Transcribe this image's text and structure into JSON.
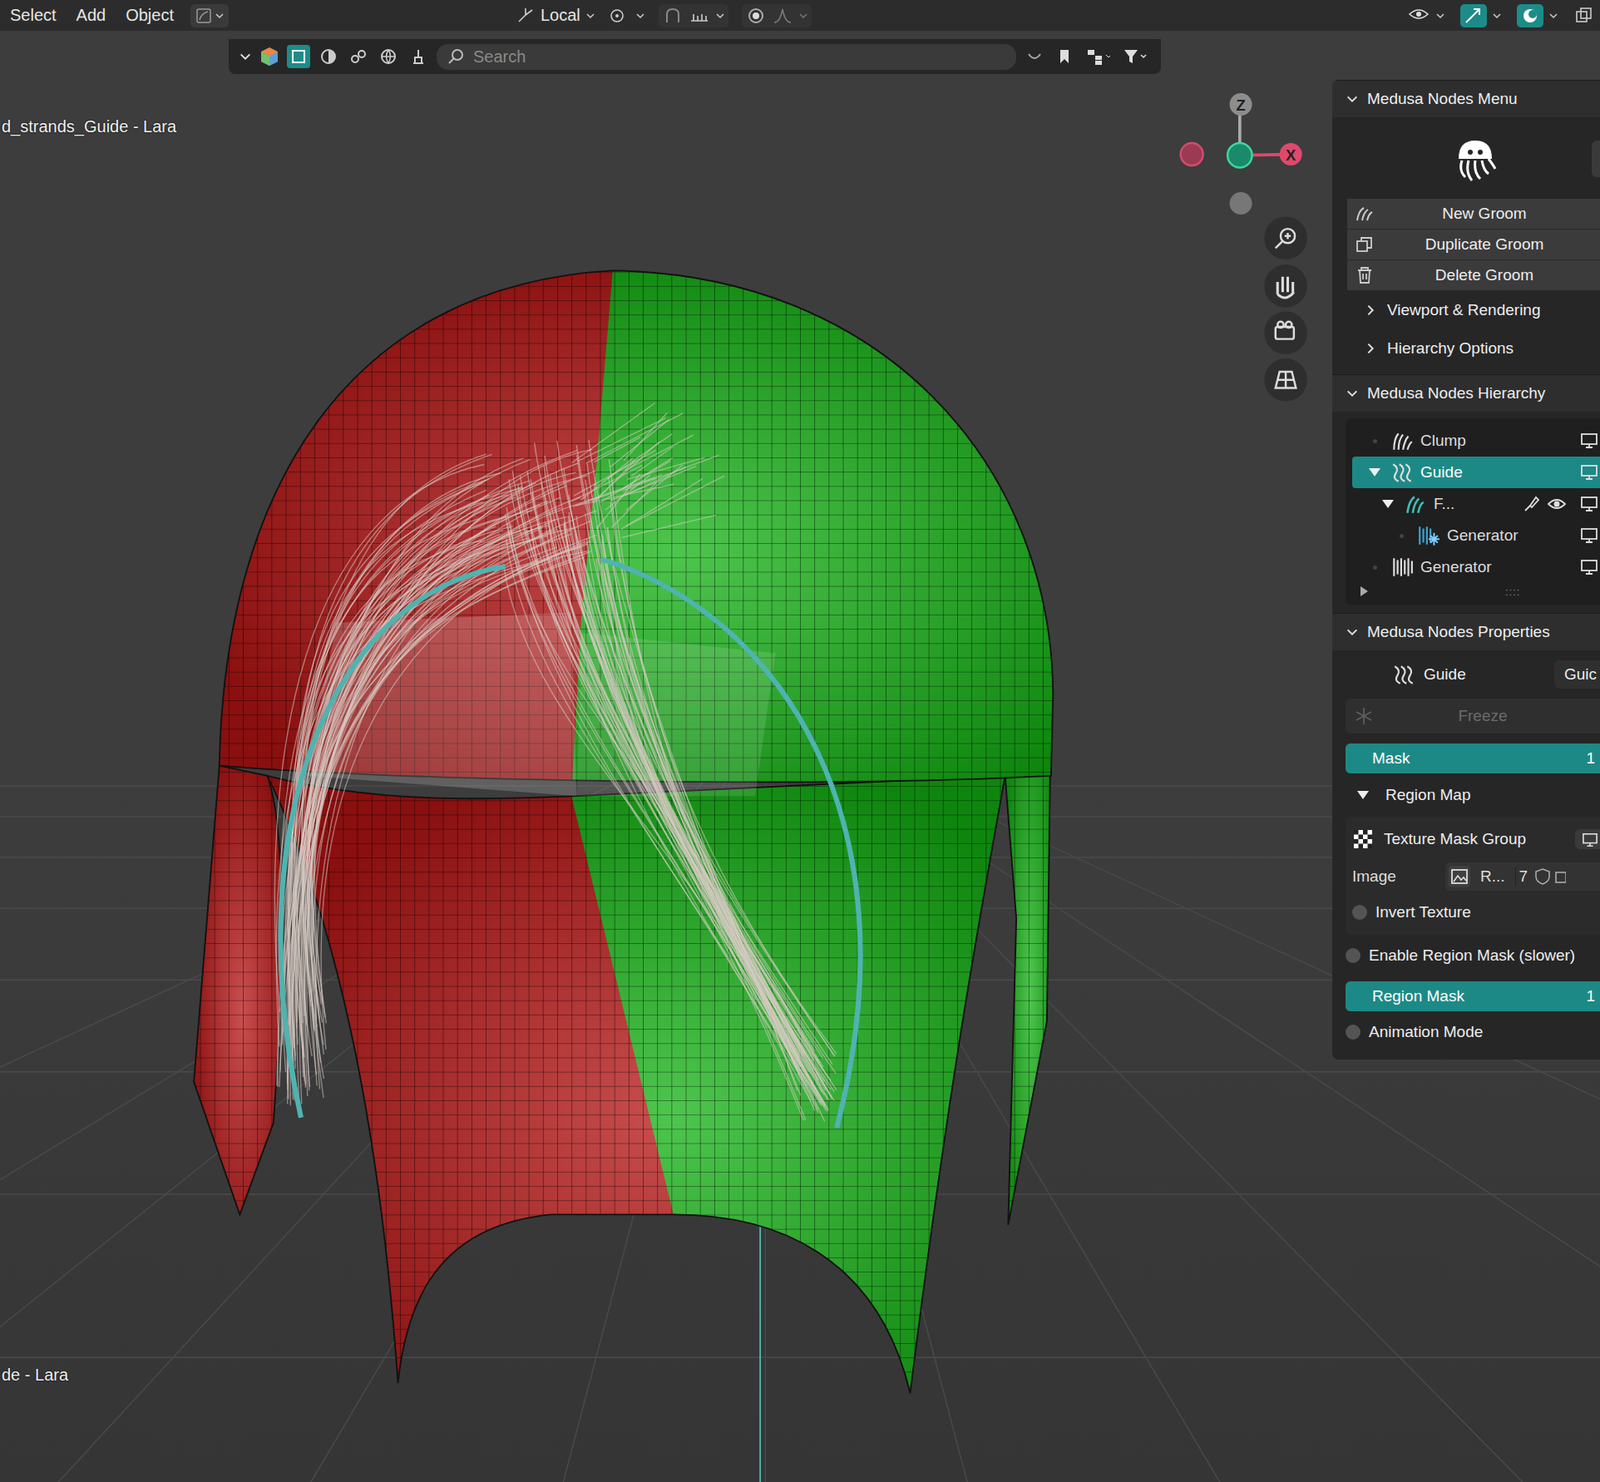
{
  "menubar": {
    "items": [
      "Select",
      "Add",
      "Object"
    ],
    "transform": "Local"
  },
  "header": {
    "search_placeholder": "Search"
  },
  "viewport": {
    "labels": [
      "d_strands_Guide - Lara",
      "de - Lara"
    ],
    "gizmo": {
      "z": "Z",
      "x": "X"
    }
  },
  "panel": {
    "menu": {
      "title": "Medusa Nodes Menu",
      "expanded": true,
      "buttons": [
        "New Groom",
        "Duplicate Groom",
        "Delete Groom"
      ],
      "subsections": [
        {
          "label": "Viewport & Rendering",
          "expanded": false
        },
        {
          "label": "Hierarchy Options",
          "expanded": false
        }
      ]
    },
    "hierarchy": {
      "title": "Medusa Nodes Hierarchy",
      "expanded": true,
      "items": [
        {
          "label": "Clump",
          "depth": 0,
          "kind": "clump",
          "expandable": false,
          "expanded": false,
          "selected": false
        },
        {
          "label": "Guide",
          "depth": 0,
          "kind": "guide",
          "expandable": true,
          "expanded": true,
          "selected": true
        },
        {
          "label": "F...",
          "depth": 1,
          "kind": "groom",
          "expandable": true,
          "expanded": true,
          "selected": false
        },
        {
          "label": "Generator",
          "depth": 2,
          "kind": "frozen",
          "expandable": false,
          "expanded": false,
          "selected": false
        },
        {
          "label": "Generator",
          "depth": 0,
          "kind": "generator",
          "expandable": false,
          "expanded": false,
          "selected": false
        }
      ],
      "footer": "::::",
      "footer_expanded": false
    },
    "properties": {
      "title": "Medusa Nodes Properties",
      "expanded": true,
      "node_type": "Guide",
      "node_name": "Guic",
      "freeze": {
        "label": "Freeze",
        "disabled": true
      },
      "mask": {
        "label": "Mask",
        "level": 1,
        "reading": "1"
      },
      "region_map": {
        "label": "Region Map",
        "expanded": true
      },
      "texture_group": {
        "label": "Texture Mask Group",
        "image_label": "Image",
        "image_name": "R...",
        "image_users": "7",
        "invert": {
          "label": "Invert Texture",
          "checked": false
        }
      },
      "rows": [
        {
          "kind": "checkbox",
          "label": "Enable Region Mask (slower)",
          "checked": false
        },
        {
          "kind": "slider",
          "label": "Region Mask",
          "level": 1,
          "reading": "1"
        },
        {
          "kind": "checkbox",
          "label": "Animation Mode",
          "checked": false
        }
      ]
    }
  }
}
